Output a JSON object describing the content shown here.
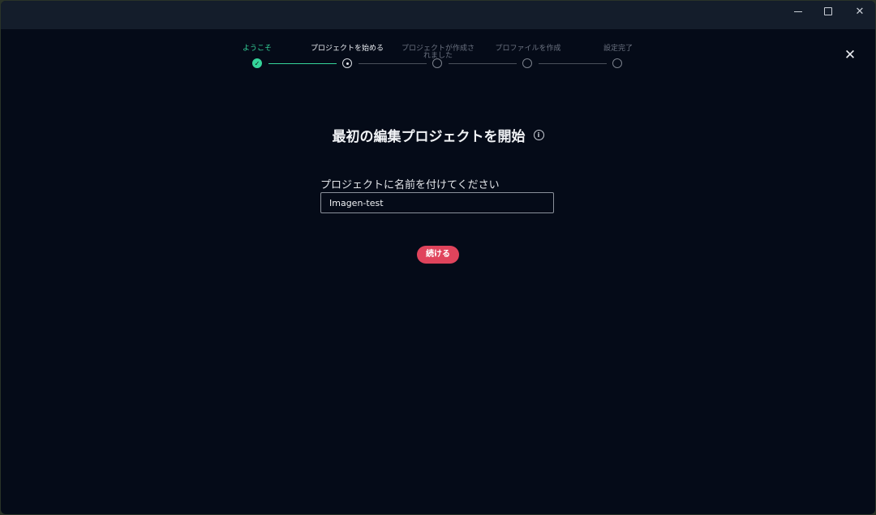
{
  "window": {
    "minimize_icon": "minimize-icon",
    "maximize_icon": "maximize-icon",
    "close_glyph": "✕"
  },
  "dialog": {
    "close_glyph": "✕"
  },
  "stepper": {
    "accent_color": "#35d49a",
    "steps": [
      {
        "label": "ようこそ",
        "state": "done",
        "check": "✓"
      },
      {
        "label": "プロジェクトを始める",
        "state": "current"
      },
      {
        "label": "プロジェクトが作成されました",
        "state": "pending"
      },
      {
        "label": "プロファイルを作成",
        "state": "pending"
      },
      {
        "label": "設定完了",
        "state": "pending"
      }
    ]
  },
  "main": {
    "title": "最初の編集プロジェクトを開始",
    "info_glyph": "i",
    "name_label": "プロジェクトに名前を付けてください",
    "name_value": "Imagen-test",
    "continue_label": "続ける",
    "button_color": "#e0445c"
  }
}
